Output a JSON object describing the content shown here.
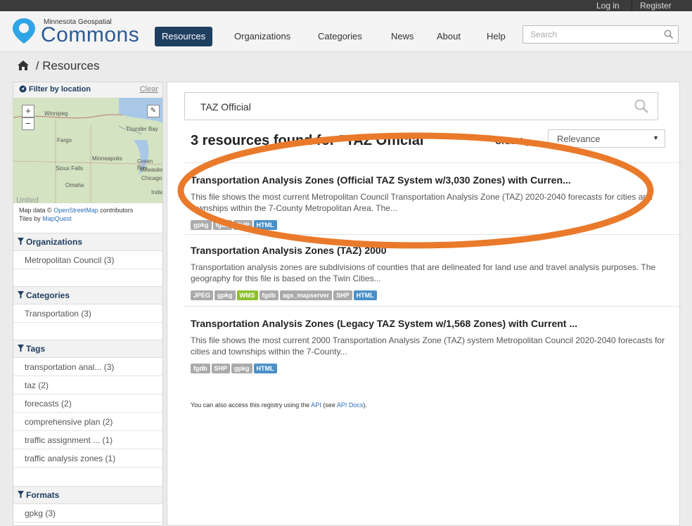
{
  "account": {
    "login": "Log in",
    "register": "Register"
  },
  "brand": {
    "small": "Minnesota Geospatial",
    "big": "Commons"
  },
  "nav": [
    "Resources",
    "Organizations",
    "Categories",
    "News",
    "About",
    "Help"
  ],
  "search": {
    "placeholder": "Search"
  },
  "breadcrumb": {
    "sep": "/",
    "page": "Resources"
  },
  "filter": {
    "title": "Filter by location",
    "clear": "Clear",
    "map_labels": [
      "Winnipeg",
      "Thunder Bay",
      "Fargo",
      "Green Bay",
      "Minneapolis",
      "Sioux Falls",
      "Milwauke",
      "Chicago",
      "Omaha",
      "India",
      "United"
    ],
    "attribution_prefix": "Map data ©",
    "attribution_link": "OpenStreetMap",
    "attribution_suffix": "contributors",
    "tiles_prefix": "Tiles by",
    "tiles_link": "MapQuest"
  },
  "facets": {
    "organizations": {
      "title": "Organizations",
      "items": [
        "Metropolitan Council (3)"
      ]
    },
    "categories": {
      "title": "Categories",
      "items": [
        "Transportation (3)"
      ]
    },
    "tags": {
      "title": "Tags",
      "items": [
        "transportation anal... (3)",
        "taz (2)",
        "forecasts (2)",
        "comprehensive plan (2)",
        "traffic assignment ... (1)",
        "traffic analysis zones (1)"
      ]
    },
    "formats": {
      "title": "Formats",
      "items": [
        "gpkg (3)"
      ]
    }
  },
  "query": {
    "value": "TAZ Official"
  },
  "results_count": "3 resources found for \"TAZ Official\"",
  "order": {
    "label": "Order by:",
    "value": "Relevance"
  },
  "results": [
    {
      "title": "Transportation Analysis Zones (Official TAZ System w/3,030 Zones) with Curren...",
      "desc": "This file shows the most current Metropolitan Council Transportation Analysis Zone (TAZ) 2020-2040 forecasts for cities and townships within the 7-County Metropolitan Area. The...",
      "tags": [
        "gpkg",
        "fgdb",
        "SHP",
        "HTML"
      ]
    },
    {
      "title": "Transportation Analysis Zones (TAZ) 2000",
      "desc": "Transportation analysis zones are subdivisions of counties that are delineated for land use and travel analysis purposes. The geography for this file is based on the Twin Cities...",
      "tags": [
        "JPEG",
        "gpkg",
        "WMS",
        "fgdb",
        "ags_mapserver",
        "SHP",
        "HTML"
      ]
    },
    {
      "title": "Transportation Analysis Zones (Legacy TAZ System w/1,568 Zones) with Current ...",
      "desc": "This file shows the most current 2000 Transportation Analysis Zone (TAZ) system Metropolitan Council 2020-2040 forecasts for cities and townships within the 7-County...",
      "tags": [
        "fgdb",
        "SHP",
        "gpkg",
        "HTML"
      ]
    }
  ],
  "api_note": {
    "prefix": "You can also access this registry using the",
    "api": "API",
    "mid": "(see",
    "docs": "API Docs",
    "suffix": ")."
  },
  "colors": {
    "nav_active": "#1f3f61",
    "highlight": "#ea7a2b",
    "html_tag": "#4a90c8",
    "wms_tag": "#8cbf2f"
  }
}
